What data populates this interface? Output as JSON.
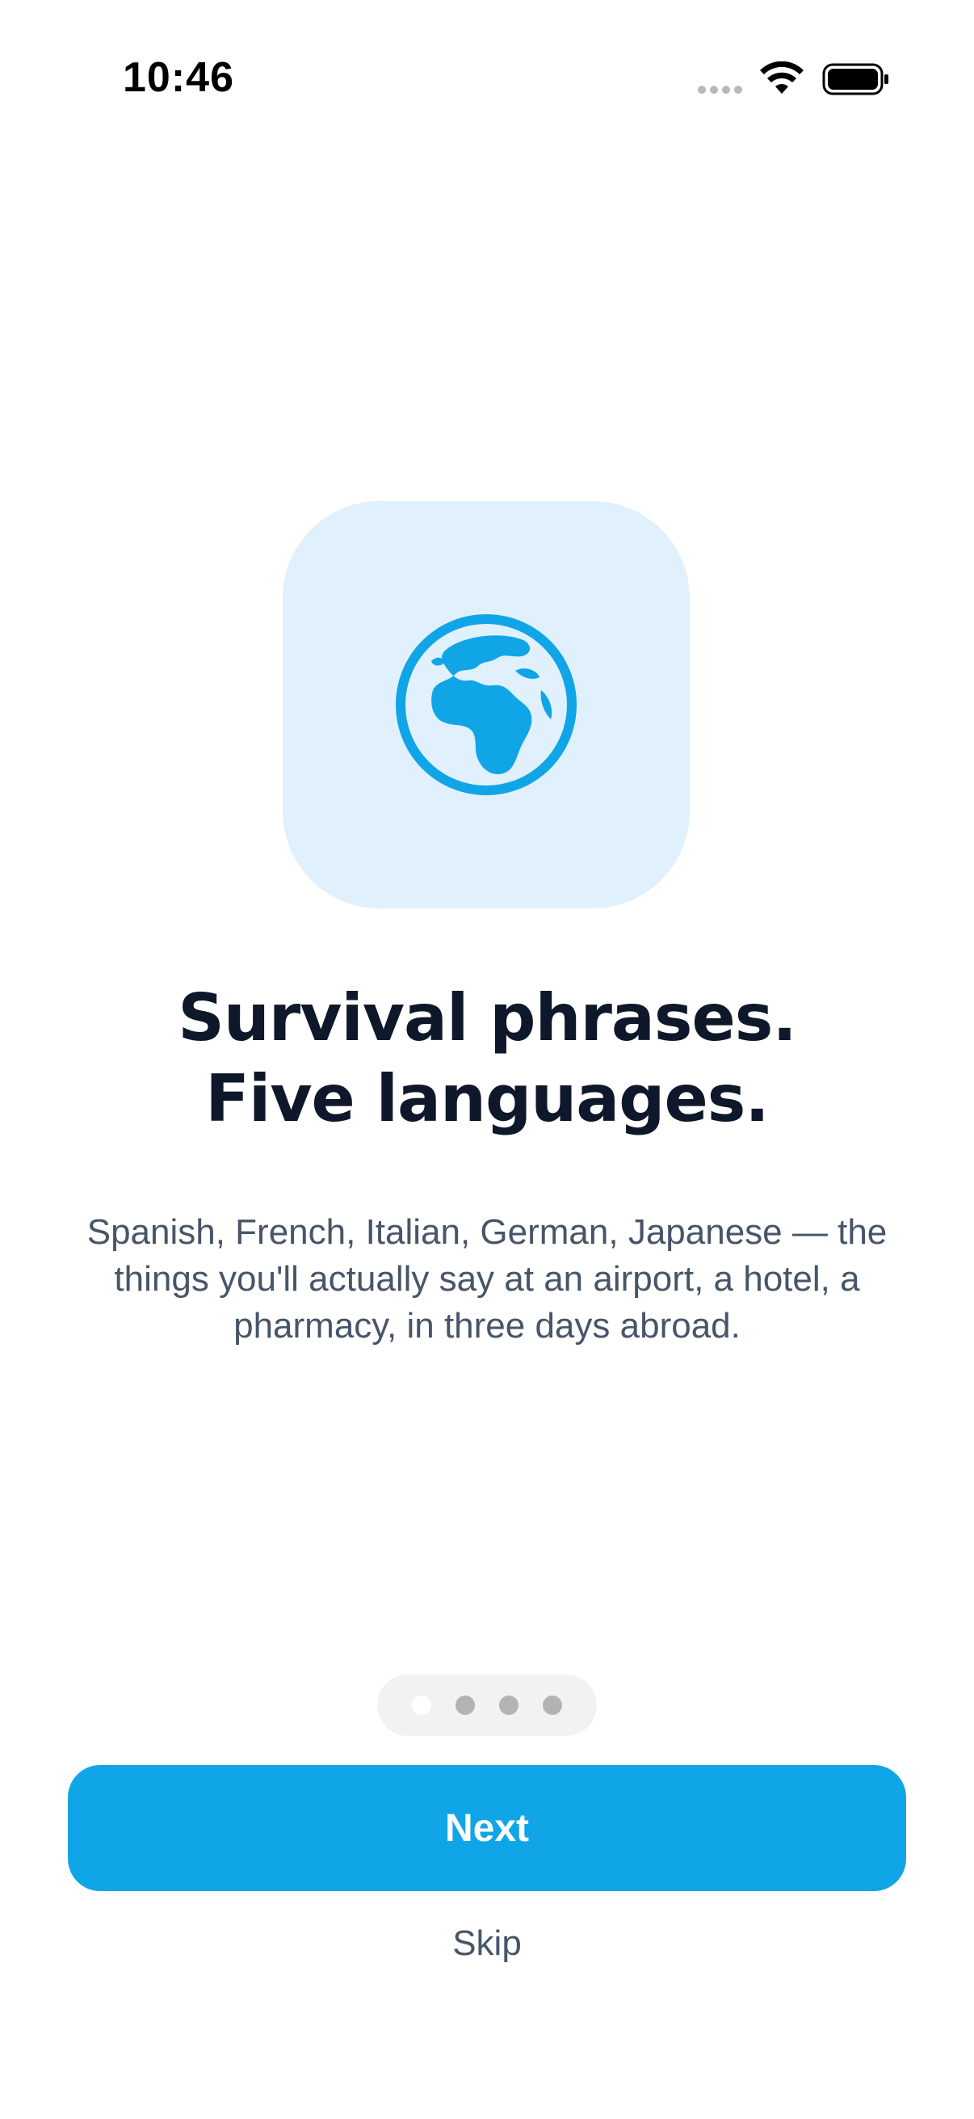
{
  "status_bar": {
    "time": "10:46",
    "wifi_icon": "wifi-icon",
    "battery_icon": "battery-icon"
  },
  "onboarding": {
    "illustration_icon": "globe-icon",
    "headline_line1": "Survival phrases.",
    "headline_line2": "Five languages.",
    "description": "Spanish, French, Italian, German, Japanese — the things you'll actually say at an airport, a hotel, a pharmacy, in three days abroad.",
    "page_count": 4,
    "current_page": 1
  },
  "actions": {
    "next_label": "Next",
    "skip_label": "Skip"
  },
  "colors": {
    "accent": "#10a5e7",
    "tile_background": "#e0f1fd",
    "headline": "#0f172a",
    "body_text": "#475569"
  }
}
